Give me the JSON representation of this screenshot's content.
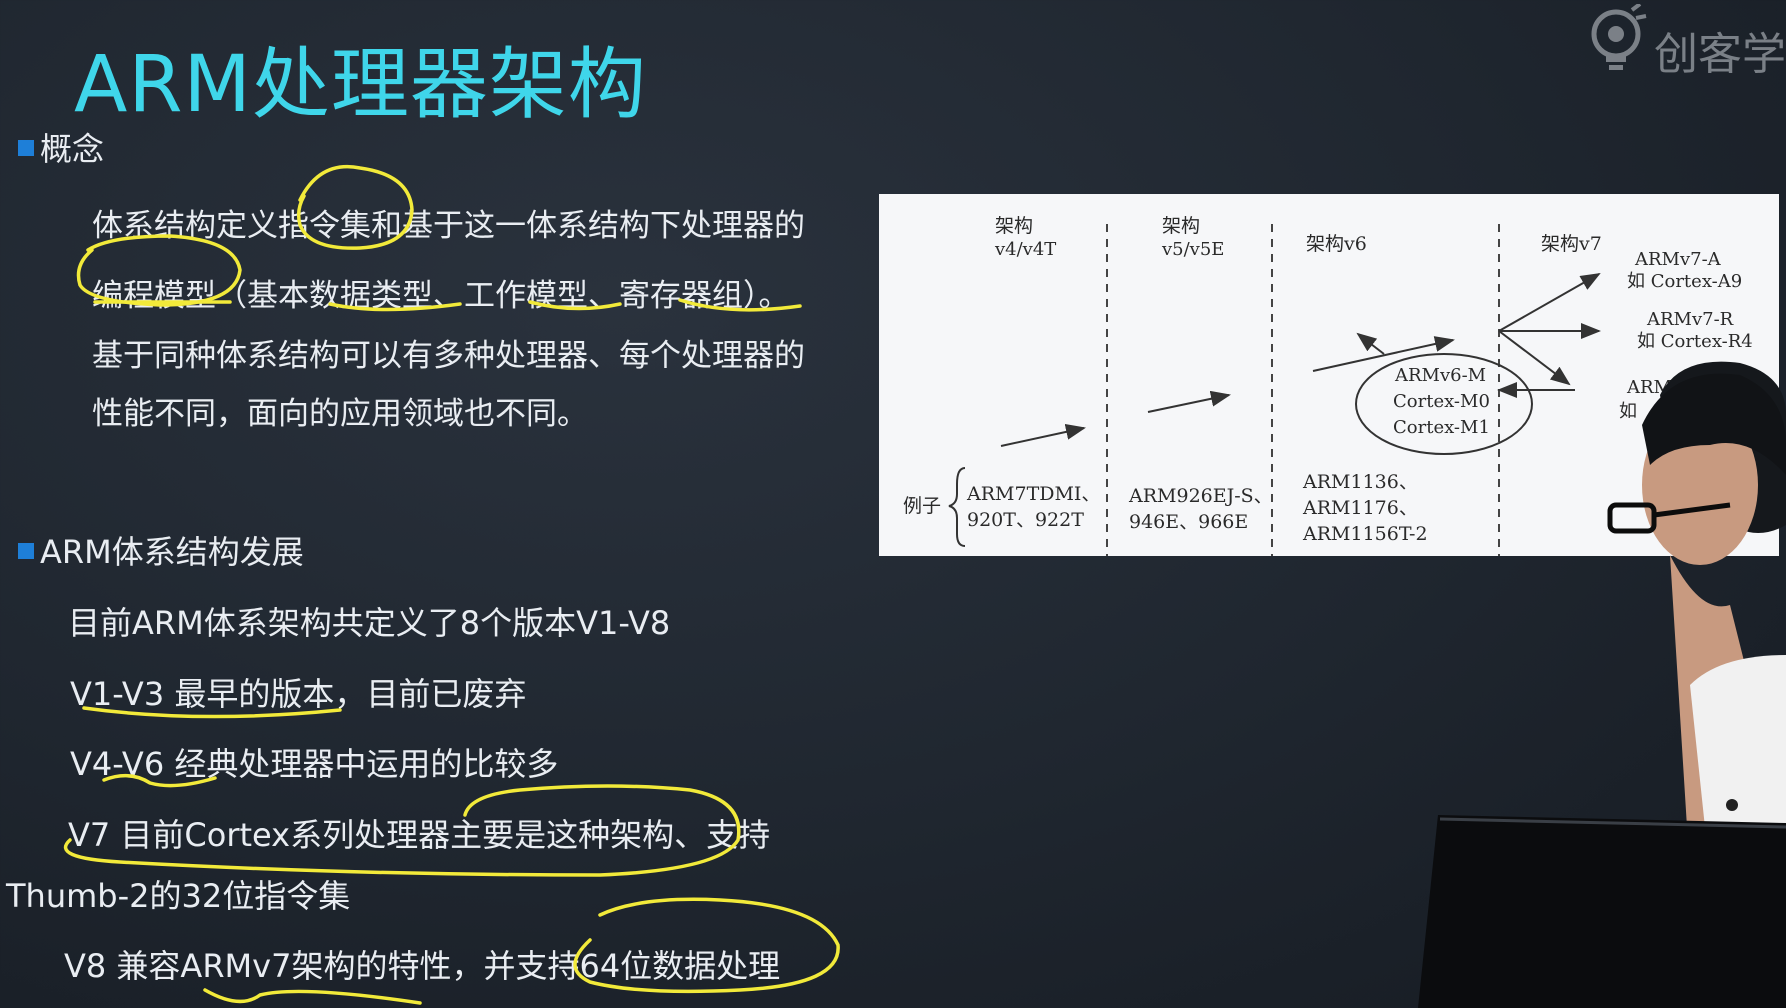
{
  "title": "ARM处理器架构",
  "watermark": "创客学",
  "section1": {
    "heading": "概念",
    "lines": [
      "体系结构定义指令集和基于这一体系结构下处理器的",
      "编程模型（基本数据类型、工作模型、寄存器组）。",
      "基于同种体系结构可以有多种处理器、每个处理器的",
      "性能不同，面向的应用领域也不同。"
    ]
  },
  "section2": {
    "heading": "ARM体系结构发展",
    "lines": [
      "目前ARM体系架构共定义了8个版本V1-V8",
      "V1-V3 最早的版本，目前已废弃",
      "V4-V6 经典处理器中运用的比较多",
      "V7  目前Cortex系列处理器主要是这种架构、支持",
      "Thumb-2的32位指令集",
      "V8 兼容ARMv7架构的特性，并支持64位数据处理"
    ]
  },
  "diagram": {
    "col1_head": "架构",
    "col1_ver": "v4/v4T",
    "col2_head": "架构",
    "col2_ver": "v5/v5E",
    "col3_head": "架构v6",
    "col4_head": "架构v7",
    "example_label": "例子",
    "ex1_line1": "ARM7TDMI、",
    "ex1_line2": "920T、922T",
    "ex2_line1": "ARM926EJ-S、",
    "ex2_line2": "946E、966E",
    "ex3_line1": "ARM1136、",
    "ex3_line2": "ARM1176、",
    "ex3_line3": "ARM1156T-2",
    "v6m_line1": "ARMv6-M",
    "v6m_line2": "Cortex-M0",
    "v6m_line3": "Cortex-M1",
    "v7a_line1": "ARMv7-A",
    "v7a_line2": "如 Cortex-A9",
    "v7r_line1": "ARMv7-R",
    "v7r_line2": "如 Cortex-R4",
    "v7m_line1": "ARM",
    "v7m_line2": "如"
  },
  "colors": {
    "title": "#3fd6ea",
    "bullet": "#1e7fd8",
    "annotation": "#f2ea3a",
    "background": "#1f262f"
  }
}
